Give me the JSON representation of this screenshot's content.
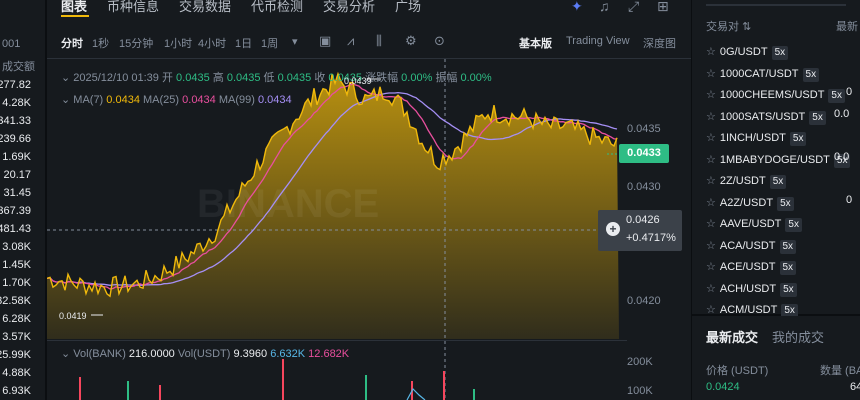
{
  "left_book": {
    "headers": [
      "001",
      "成交额"
    ],
    "values": [
      "277.82",
      "4.28K",
      "341.33",
      "239.66",
      "1.69K",
      "20.17",
      "31.45",
      "367.39",
      "481.43",
      "3.08K",
      "1.45K",
      "1.70K",
      "32.58K",
      "6.28K",
      "3.57K",
      "25.99K",
      "4.88K",
      "6.93K"
    ]
  },
  "top_tabs": [
    "图表",
    "币种信息",
    "交易数据",
    "代币检测",
    "交易分析",
    "广场"
  ],
  "top_icons": [
    "magic-icon",
    "bell-icon",
    "expand-icon",
    "grid-icon"
  ],
  "toolbar": {
    "timeframes": [
      "分时",
      "1秒",
      "15分钟",
      "1小时",
      "4小时",
      "1日",
      "1周"
    ],
    "more_arrow": "▾",
    "tools": [
      "▣",
      "⩘",
      "⫼",
      "⚙",
      "⊙"
    ],
    "views": [
      "基本版",
      "Trading View",
      "深度图"
    ]
  },
  "info": {
    "datetime": "2025/12/10 01:39",
    "open_label": "开",
    "open": "0.0435",
    "high_label": "高",
    "high": "0.0435",
    "low_label": "低",
    "low": "0.0435",
    "close_label": "收",
    "close": "0.0435",
    "chg_label": "涨跌幅",
    "chg": "0.00%",
    "amp_label": "振幅",
    "amp": "0.00%",
    "ma7_label": "MA(7)",
    "ma7": "0.0434",
    "ma25_label": "MA(25)",
    "ma25": "0.0434",
    "ma99_label": "MA(99)",
    "ma99": "0.0434"
  },
  "price_axis": [
    "0.0435",
    "0.0430",
    "0.0420"
  ],
  "last_price": "0.0433",
  "crosshair": {
    "price": "0.0426",
    "pct": "+0.4717%"
  },
  "marks": {
    "high": "0.0439",
    "low": "0.0419"
  },
  "watermark": "BINANCE",
  "volume": {
    "label": "Vol(BANK)",
    "bank": "216.0000",
    "usdt_label": "Vol(USDT)",
    "usdt": "9.3960",
    "v1": "6.632K",
    "v2": "12.682K",
    "axis": [
      "200K",
      "100K"
    ]
  },
  "pairs_header": {
    "left": "交易对",
    "right": "最新"
  },
  "pairs": [
    {
      "name": "0G/USDT",
      "lev": "5x",
      "extra": ""
    },
    {
      "name": "1000CAT/USDT",
      "lev": "5x",
      "extra": ""
    },
    {
      "name": "1000CHEEMS/USDT",
      "lev": "5x",
      "extra": "0"
    },
    {
      "name": "1000SATS/USDT",
      "lev": "5x",
      "extra": "0.0"
    },
    {
      "name": "1INCH/USDT",
      "lev": "5x",
      "extra": ""
    },
    {
      "name": "1MBABYDOGE/USDT",
      "lev": "5x",
      "extra": "0.0"
    },
    {
      "name": "2Z/USDT",
      "lev": "5x",
      "extra": ""
    },
    {
      "name": "A2Z/USDT",
      "lev": "5x",
      "extra": "0"
    },
    {
      "name": "AAVE/USDT",
      "lev": "5x",
      "extra": ""
    },
    {
      "name": "ACA/USDT",
      "lev": "5x",
      "extra": ""
    },
    {
      "name": "ACE/USDT",
      "lev": "5x",
      "extra": ""
    },
    {
      "name": "ACH/USDT",
      "lev": "5x",
      "extra": ""
    },
    {
      "name": "ACM/USDT",
      "lev": "5x",
      "extra": ""
    }
  ],
  "trades": {
    "tabs": [
      "最新成交",
      "我的成交"
    ],
    "price_header": "价格 (USDT)",
    "qty_header": "数量 (BA",
    "price": "0.0424",
    "qty": "64"
  }
}
